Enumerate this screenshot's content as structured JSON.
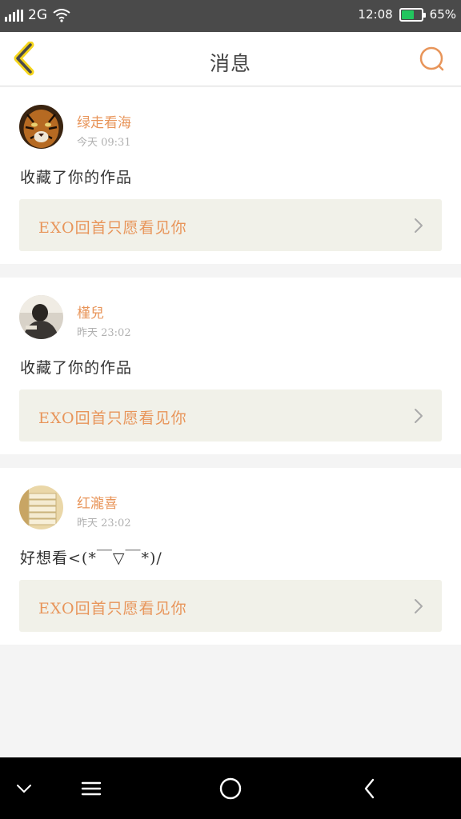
{
  "status_bar": {
    "network": "2G",
    "time": "12:08",
    "battery": "65%",
    "battery_level": 0.65,
    "battery_color": "#22c55e"
  },
  "header": {
    "title": "消息",
    "back_icon": "chevron-left-icon",
    "search_icon": "search-icon",
    "accent_color": "#e8955a"
  },
  "messages": [
    {
      "username": "绿走看海",
      "time": "今天 09:31",
      "text": "收藏了你的作品",
      "link_title": "EXO回首只愿看见你"
    },
    {
      "username": "槿兒",
      "time": "昨天 23:02",
      "text": "收藏了你的作品",
      "link_title": "EXO回首只愿看见你"
    },
    {
      "username": "红瀧喜",
      "time": "昨天 23:02",
      "text": "好想看<(*￣▽￣*)/",
      "link_title": "EXO回首只愿看见你"
    }
  ],
  "nav_bar": {
    "icons": [
      "chevron-down-icon",
      "menu-icon",
      "home-icon",
      "back-icon"
    ]
  }
}
